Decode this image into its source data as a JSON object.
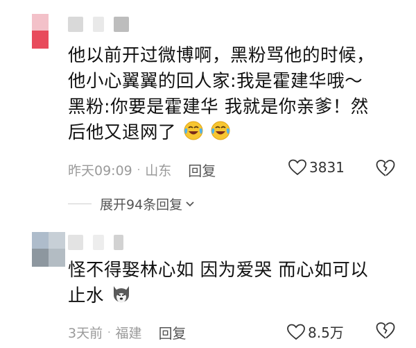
{
  "comments": [
    {
      "text_lines": [
        "他以前开过微博啊，黑粉骂他的时候，",
        "他小心翼翼的回人家:我是霍建华哦～",
        "黑粉:你要是霍建华 我就是你亲爹！然",
        "后他又退网了"
      ],
      "emoji": [
        "laughing-tears-emoji",
        "laughing-tears-emoji"
      ],
      "time": "昨天09:09",
      "location": "山东",
      "reply_label": "回复",
      "likes": "3831",
      "expand_label": "展开94条回复"
    },
    {
      "text_lines": [
        "怪不得娶林心如 因为爱哭 而心如可以",
        "止水"
      ],
      "emoji": [
        "husky-dog-emoji"
      ],
      "time": "3天前",
      "location": "福建",
      "reply_label": "回复",
      "likes": "8.5万"
    }
  ],
  "colors": {
    "meta": "#9a9a9a",
    "avatar1": [
      "#f1a7b3",
      "#e84b5c"
    ],
    "avatar2": [
      "#9fb0c0",
      "#7f8a94"
    ]
  }
}
